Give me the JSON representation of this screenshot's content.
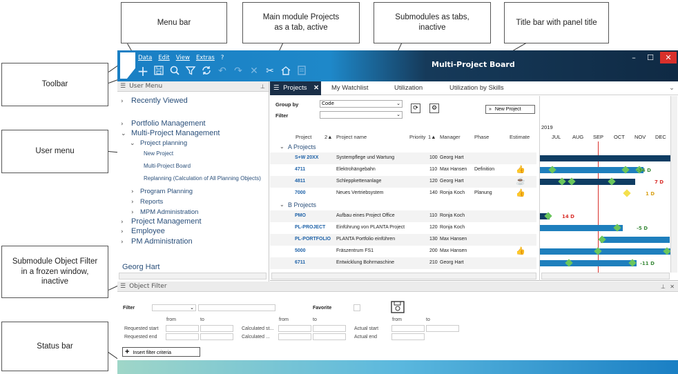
{
  "callouts": {
    "menu_bar": "Menu bar",
    "main_module": "Main module Projects\nas a tab, active",
    "submodules": "Submodules as tabs,\ninactive",
    "title_bar": "Title bar with panel title",
    "toolbar": "Toolbar",
    "user_menu": "User menu",
    "object_filter": "Submodule Object Filter\nin a frozen window,\ninactive",
    "status_bar": "Status bar"
  },
  "menu": [
    "Data",
    "Edit",
    "View",
    "Extras",
    "?"
  ],
  "toolbar_icons": [
    "plus-icon",
    "save-icon",
    "search-icon",
    "filter-icon",
    "refresh-icon",
    "undo-icon",
    "redo-icon",
    "delete-icon",
    "tools-icon",
    "home-icon",
    "report-icon"
  ],
  "window": {
    "title": "Multi-Project Board",
    "minimize": "–",
    "maximize": "☐",
    "close": "✕"
  },
  "user_menu": {
    "header": "User Menu",
    "items": [
      {
        "label": "Recently Viewed"
      },
      {
        "label": "Portfolio Management"
      },
      {
        "label": "Multi-Project Management"
      },
      {
        "label": "Project planning"
      },
      {
        "label": "New Project"
      },
      {
        "label": "Multi-Project Board"
      },
      {
        "label": "Replanning (Calculation of All Planning Objects)"
      },
      {
        "label": "Program Planning"
      },
      {
        "label": "Reports"
      },
      {
        "label": "MPM Administration"
      },
      {
        "label": "Project Management"
      },
      {
        "label": "Employee"
      },
      {
        "label": "PM Administration"
      }
    ],
    "user": "Georg Hart"
  },
  "tabs": [
    {
      "label": "Projects",
      "active": true
    },
    {
      "label": "My Watchlist"
    },
    {
      "label": "Utilization"
    },
    {
      "label": "Utilization by Skills"
    }
  ],
  "board": {
    "group_by_label": "Group by",
    "group_by_value": "Code",
    "filter_label": "Filter",
    "new_project": "New Project",
    "columns": [
      "Project",
      "2▲",
      "Project name",
      "Priority",
      "1▲",
      "Manager",
      "Phase",
      "Estimate"
    ],
    "groups": [
      {
        "name": "A Projects",
        "rows": [
          {
            "id": "S+W 20XX",
            "name": "Systempflege und Wartung",
            "priority": "100",
            "manager": "Georg Hart",
            "phase": "",
            "estimate": ""
          },
          {
            "id": "4711",
            "name": "Elektrohängebahn",
            "priority": "110",
            "manager": "Max Hansen",
            "phase": "Definition",
            "estimate": "thumb"
          },
          {
            "id": "4811",
            "name": "Schleppkettenanlage",
            "priority": "120",
            "manager": "Georg Hart",
            "phase": "",
            "estimate": "cup"
          },
          {
            "id": "7000",
            "name": "Neues Vertriebsystem",
            "priority": "140",
            "manager": "Ronja Koch",
            "phase": "Planung",
            "estimate": "thumb"
          }
        ]
      },
      {
        "name": "B Projects",
        "rows": [
          {
            "id": "PMO",
            "name": "Aufbau eines Project Office",
            "priority": "110",
            "manager": "Ronja Koch",
            "phase": "",
            "estimate": ""
          },
          {
            "id": "PL-PROJECT",
            "name": "Einführung von PLANTA Project",
            "priority": "120",
            "manager": "Ronja Koch",
            "phase": "",
            "estimate": ""
          },
          {
            "id": "PL-PORTFOLIO",
            "name": "PLANTA Portfolio einführen",
            "priority": "130",
            "manager": "Max Hansen",
            "phase": "",
            "estimate": ""
          },
          {
            "id": "5000",
            "name": "Fräszentrum FS1",
            "priority": "200",
            "manager": "Max Hansen",
            "phase": "",
            "estimate": "thumb"
          },
          {
            "id": "6711",
            "name": "Entwicklung Bohrmaschine",
            "priority": "210",
            "manager": "Georg Hart",
            "phase": "",
            "estimate": ""
          }
        ]
      }
    ],
    "gantt": {
      "year": "2019",
      "months": [
        "JUL",
        "AUG",
        "SEP",
        "OCT",
        "NOV",
        "DEC"
      ],
      "labels": [
        "-34 D",
        "7 D",
        "1 D",
        "14 D",
        "-5 D",
        "-11 D"
      ]
    }
  },
  "object_filter": {
    "header": "Object Filter",
    "filter": "Filter",
    "favorite": "Favorite",
    "from": "from",
    "to": "to",
    "requested_start": "Requested start",
    "requested_end": "Requested end",
    "calculated_start": "Calculated st...",
    "calculated_end": "Calculated ...",
    "actual_start": "Actual start",
    "actual_end": "Actual end",
    "insert": "Insert filter criteria"
  },
  "colors": {
    "accent": "#1a7fc4",
    "dark": "#0f2a44",
    "bar": "#1b6aa3",
    "milestone": "#6ac55c",
    "late": "#d9302b"
  }
}
